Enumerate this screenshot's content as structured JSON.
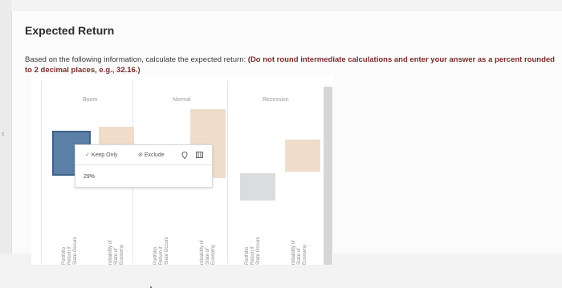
{
  "page": {
    "title": "Expected Return",
    "question_plain": "Based on the following information, calculate the expected return: ",
    "question_bold": "(Do not round intermediate calculations and enter your answer as a percent rounded to 2 decimal places, e.g., 32.16.)",
    "left_mark": "s"
  },
  "chart": {
    "categories": [
      {
        "label": "Boom"
      },
      {
        "label": "Normal"
      },
      {
        "label": "Recession"
      }
    ],
    "axis_labels": [
      [
        "Portfolio",
        "Return if",
        "State Occurs"
      ],
      [
        "robability of",
        "State of",
        "Economy"
      ],
      [
        "Portfolio",
        "Return if",
        "State Occurs"
      ],
      [
        "robability of",
        "State of",
        "Economy"
      ],
      [
        "Portfolio",
        "Return if",
        "State Occurs"
      ],
      [
        "robability of",
        "State of",
        "Economy"
      ]
    ],
    "colors": {
      "selected": "#5b7fa6",
      "probability": "#efdccb",
      "recession_return": "#dadcdd"
    }
  },
  "tooltip": {
    "keep_only": "Keep Only",
    "exclude": "Exclude",
    "value": "29%"
  }
}
